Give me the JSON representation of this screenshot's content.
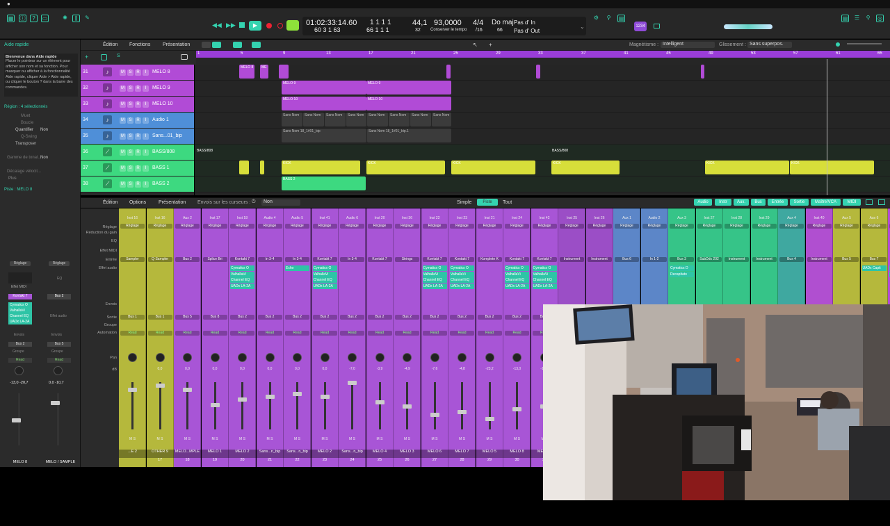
{
  "menubar": {
    "apple": ""
  },
  "control_bar": {
    "timecode": "01:02:33:14.60",
    "timecode_sub": "60  3  1  63",
    "position": "1  1  1   1",
    "position_sub": "66  1  1   1",
    "division": "32",
    "bpm": "44,1",
    "tempo": "93,0000",
    "tempo_sub": "Conserver le tempo",
    "signature": "4/4",
    "signature_sub": "/16",
    "key": "Do maj",
    "key_sub": "66",
    "pas_in": "Pas d' In",
    "pas_out": "Pas d' Out",
    "badge": "1234"
  },
  "quick_help": {
    "title": "Aide rapide",
    "heading": "Bienvenue dans Aide rapide",
    "body": "Placer le pointeur sur un élément pour afficher son nom et sa fonction. Pour masquer ou afficher à la fonctionnalité Aide rapide, cliquer Aide > Aide rapide, ou cliquer le bouton ? dans la barre des commandes.",
    "region": "Région : 4 sélectionnés",
    "rows": [
      {
        "label": "Muet",
        "value": ""
      },
      {
        "label": "Boucle",
        "value": ""
      },
      {
        "label": "Quantifier",
        "value": "Non"
      },
      {
        "label": "Q-Swing",
        "value": ""
      },
      {
        "label": "Transposer",
        "value": ""
      },
      {
        "label": "Gamme de tonal...",
        "value": "Non"
      },
      {
        "label": "Décalage vélocit...",
        "value": ""
      }
    ],
    "plus": "Plus",
    "piste": "Piste : MELO 8"
  },
  "tracks_menu": {
    "edition": "Édition",
    "fonctions": "Fonctions",
    "presentation": "Présentation",
    "magnetisme_label": "Magnétisme :",
    "magnetisme_value": "Intelligent",
    "glissement_label": "Glissement :",
    "glissement_value": "Sans superpos."
  },
  "ruler": [
    "1",
    "5",
    "9",
    "13",
    "17",
    "21",
    "25",
    "29",
    "33",
    "37",
    "41",
    "45",
    "49",
    "53",
    "57",
    "61",
    "65"
  ],
  "tracks": [
    {
      "num": "31",
      "name": "MELO 8",
      "color": "#b14bd6"
    },
    {
      "num": "32",
      "name": "MELO 9",
      "color": "#b14bd6"
    },
    {
      "num": "33",
      "name": "MELO 10",
      "color": "#b14bd6"
    },
    {
      "num": "34",
      "name": "Audio 1",
      "color": "#4f8fd8"
    },
    {
      "num": "35",
      "name": "Sans...01_bip",
      "color": "#4f8fd8"
    },
    {
      "num": "36",
      "name": "BASS/808",
      "color": "#3dd980"
    },
    {
      "num": "37",
      "name": "BASS 1",
      "color": "#3dd980"
    },
    {
      "num": "38",
      "name": "BASS 2",
      "color": "#3dd980"
    }
  ],
  "regions": {
    "melo8a": "MELO 8",
    "melo8b": "ME",
    "melo9a": "MELO 9",
    "melo9b": "MELO 9",
    "melo10a": "MELO 10",
    "melo10b": "MELO 10",
    "sansnom": "Sans Nom",
    "bip1": "Sans Nom 18_1#01_bip",
    "bip2": "Sans Nom 18_1#01_bip.1",
    "bass808a": "BASS/808",
    "bass808b": "BASS/808",
    "kick": "KICK",
    "bass2": "BASS 2"
  },
  "mixer_menu": {
    "edition": "Édition",
    "options": "Options",
    "presentation": "Présentation",
    "envois_label": "Envois sur les curseurs :",
    "envois_value": "Non",
    "simple": "Simple",
    "piste": "Piste",
    "tout": "Tout",
    "filters": [
      "Audio",
      "Instr",
      "Aux.",
      "Bus",
      "Entrée",
      "Sortie",
      "Maître/VCA",
      "MIDI"
    ]
  },
  "mixer_labels": {
    "reglage": "Réglage",
    "gain": "Réduction du gain",
    "eq": "EQ",
    "midi": "Effet MIDI",
    "entree": "Entrée",
    "audio": "Effet audio",
    "envois": "Envois",
    "sortie": "Sortie",
    "groupe": "Groupe",
    "automation": "Automation",
    "pan": "Pan",
    "db": "dB"
  },
  "inspector": {
    "left": {
      "reglage": "Réglage",
      "midi": "Effet MIDI",
      "inst": "Kontakt 7",
      "plugins": [
        "Cymatics O",
        "ValhallaVi",
        "Channel EQ",
        "UADx LA-2A"
      ],
      "envois": "Envois",
      "sortie": "Bus 2",
      "groupe": "Groupe",
      "read": "Read",
      "vals": "-13,0  -20,7",
      "name": "MELO 8"
    },
    "right": {
      "reglage": "Réglage",
      "eq": "EQ",
      "inst": "Bus 2",
      "audio": "Effet audio",
      "envois": "Envois",
      "sortie": "Bus 5",
      "groupe": "Groupe",
      "read": "Read",
      "vals": "0,0  -10,7",
      "name": "MELO / SAMPLE"
    }
  },
  "strips": [
    {
      "top": "Inst 16",
      "inst": "Sampler",
      "out": "Bus 1",
      "pan": "",
      "db": "",
      "name": "...E 2",
      "num": "",
      "color": "#b5b83c"
    },
    {
      "top": "Inst 16",
      "inst": "Q-Sampler",
      "out": "Bus 1",
      "pan": "0,0",
      "db": "",
      "name": "OTHER 9",
      "num": "17",
      "color": "#b5b83c"
    },
    {
      "top": "Aux 2",
      "inst": "Bus 2",
      "out": "Bus 5",
      "pan": "0,0",
      "db": "-10,7",
      "name": "MELO...MPLE",
      "num": "18",
      "color": "#a855d6"
    },
    {
      "top": "Inst 17",
      "inst": "Splice Bri",
      "out": "Bus 8",
      "pan": "0,0",
      "db": "-10,7",
      "name": "MELO 1",
      "num": "19",
      "color": "#a855d6"
    },
    {
      "top": "Inst 18",
      "inst": "Kontakt 7",
      "out": "Bus 2",
      "pan": "0,0",
      "db": "-12,0",
      "name": "MELO 2",
      "num": "20",
      "color": "#a855d6"
    },
    {
      "top": "Audio 4",
      "inst": "In 3-4",
      "out": "Bus 2",
      "pan": "0,0",
      "db": "-13,3",
      "name": "Sans...n_bip",
      "num": "21",
      "color": "#a855d6"
    },
    {
      "top": "Audio 5",
      "inst": "In 3-4",
      "out": "Bus 2",
      "pan": "0,0",
      "db": "-10,7",
      "name": "Sans...n_bip",
      "num": "22",
      "color": "#a855d6"
    },
    {
      "top": "Inst 41",
      "inst": "Kontakt 7",
      "out": "Bus 2",
      "pan": "0,0",
      "db": "-10,7",
      "name": "MELO 2",
      "num": "23",
      "color": "#a855d6"
    },
    {
      "top": "Audio 6",
      "inst": "In 3-4",
      "out": "Bus 2",
      "pan": "-7,0",
      "db": "-22,0",
      "name": "Sans...n_bip",
      "num": "24",
      "color": "#a855d6"
    },
    {
      "top": "Inst 20",
      "inst": "Kontakt 7",
      "out": "Bus 2",
      "pan": "-3,9",
      "db": "-17,0",
      "name": "MELO 4",
      "num": "25",
      "color": "#a855d6"
    },
    {
      "top": "Inst 36",
      "inst": "Strings",
      "out": "Bus 2",
      "pan": "-4,9",
      "db": "",
      "name": "MELO 3",
      "num": "26",
      "color": "#a855d6"
    },
    {
      "top": "Inst 22",
      "inst": "Kontakt 7",
      "out": "Bus 2",
      "pan": "-7,6",
      "db": "-26,8",
      "name": "MELO 6",
      "num": "27",
      "color": "#a855d6"
    },
    {
      "top": "Inst 23",
      "inst": "Kontakt 7",
      "out": "Bus 2",
      "pan": "-4,8",
      "db": "-22,0",
      "name": "MELO 7",
      "num": "28",
      "color": "#a855d6"
    },
    {
      "top": "Inst 21",
      "inst": "Komplete K",
      "out": "Bus 2",
      "pan": "-23,2",
      "db": "",
      "name": "MELO 5",
      "num": "29",
      "color": "#a855d6"
    },
    {
      "top": "Inst 24",
      "inst": "Kontakt 7",
      "out": "Bus 2",
      "pan": "-13,0",
      "db": "-21,2",
      "name": "MELO 8",
      "num": "30",
      "color": "#a855d6"
    },
    {
      "top": "Inst 42",
      "inst": "Kontakt 7",
      "out": "Bus 2",
      "pan": "-13,0",
      "db": "-20,7",
      "name": "MELO 8",
      "num": "31",
      "color": "#a855d6"
    },
    {
      "top": "Inst 25",
      "inst": "Instrument",
      "out": "",
      "pan": "",
      "db": "",
      "name": "",
      "num": "",
      "color": "#9b4ec6"
    },
    {
      "top": "Inst 26",
      "inst": "Instrument",
      "out": "",
      "pan": "",
      "db": "",
      "name": "",
      "num": "",
      "color": "#9b4ec6"
    },
    {
      "top": "Aux 1",
      "inst": "Bus 6",
      "out": "",
      "pan": "",
      "db": "",
      "name": "",
      "num": "",
      "color": "#5c86c8"
    },
    {
      "top": "Audio 2",
      "inst": "In 1-2",
      "out": "",
      "pan": "",
      "db": "",
      "name": "",
      "num": "",
      "color": "#5c86c8"
    },
    {
      "top": "Aux 3",
      "inst": "Bus 3",
      "out": "",
      "pan": "",
      "db": "",
      "name": "",
      "num": "",
      "color": "#36c488"
    },
    {
      "top": "Inst 27",
      "inst": "SubDdx 202",
      "out": "",
      "pan": "",
      "db": "",
      "name": "",
      "num": "",
      "color": "#36c488"
    },
    {
      "top": "Inst 28",
      "inst": "Instrument",
      "out": "",
      "pan": "",
      "db": "",
      "name": "",
      "num": "",
      "color": "#36c488"
    },
    {
      "top": "Inst 29",
      "inst": "Instrument",
      "out": "",
      "pan": "",
      "db": "",
      "name": "",
      "num": "",
      "color": "#36c488"
    },
    {
      "top": "Aux 4",
      "inst": "Bus 4",
      "out": "",
      "pan": "",
      "db": "",
      "name": "",
      "num": "",
      "color": "#3fa8a0"
    },
    {
      "top": "Inst 40",
      "inst": "Instrument",
      "out": "",
      "pan": "",
      "db": "",
      "name": "",
      "num": "",
      "color": "#b04fd0"
    },
    {
      "top": "Aux 5",
      "inst": "Bus 5",
      "out": "",
      "pan": "",
      "db": "",
      "name": "",
      "num": "",
      "color": "#b5b83c"
    },
    {
      "top": "Aux 6",
      "inst": "Bus 7",
      "out": "",
      "pan": "",
      "db": "",
      "name": "",
      "num": "",
      "color": "#b5b83c"
    },
    {
      "top": "Sortie",
      "inst": "",
      "out": "",
      "pan": "",
      "db": "",
      "name": "",
      "num": "",
      "color": "#b14bd6"
    }
  ],
  "strip_plugins": {
    "p1": [
      "Cymatics O",
      "ValhallaVi",
      "Channel EQ",
      "UADx LA-2A"
    ],
    "p2": [
      "Cymatics O",
      "ValhallaVi",
      "Channel EQ",
      "UADx LA-2A"
    ],
    "echo": "Echo",
    "p3": [
      "Cymatics O",
      "ValhallaVi",
      "Channel EQ",
      "UADx LA-2A"
    ],
    "p4": [
      "Cymatics O",
      "ValhallaVi",
      "Channel EQ",
      "UADx LA-2A"
    ],
    "p5": [
      "Cymatics D",
      "Decapitato"
    ],
    "uad": "UADx Capit",
    "limit": "Limi",
    "muse": "MusePl"
  },
  "read_label": "Read",
  "reglage_label": "Réglage"
}
